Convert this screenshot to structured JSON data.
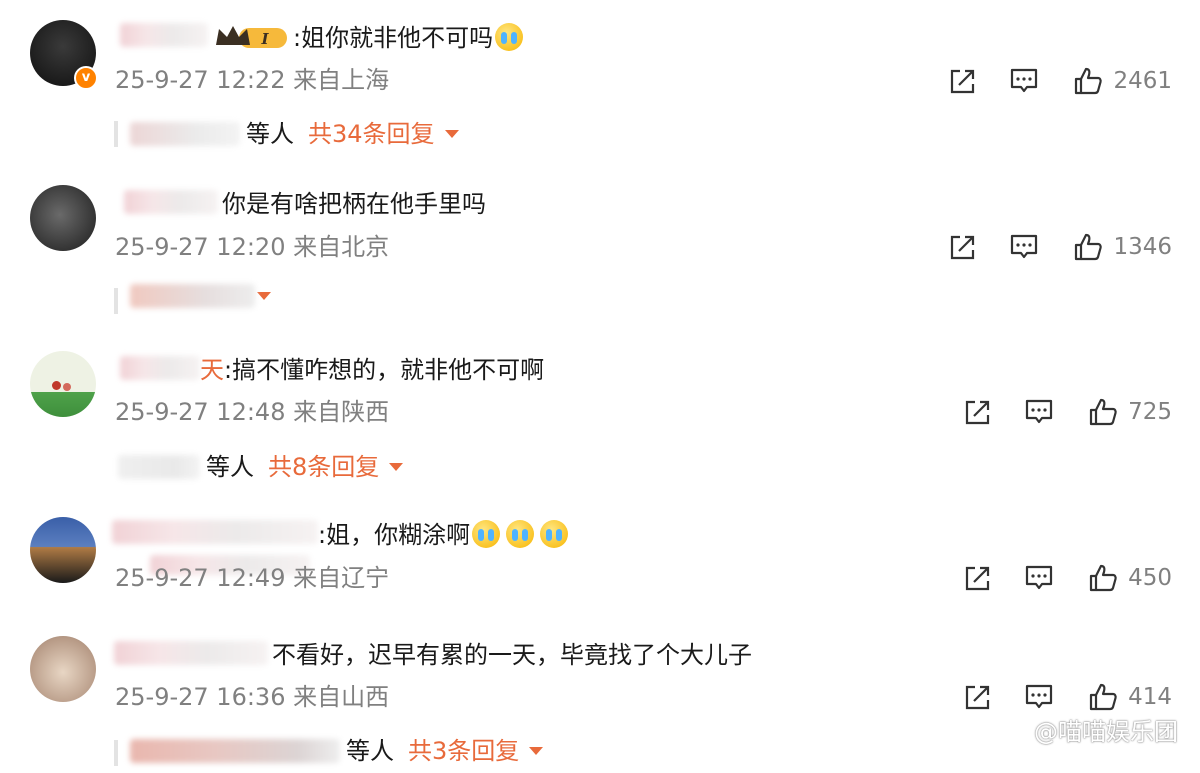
{
  "comments": [
    {
      "text": ":姐你就非他不可吗",
      "emoji_name": "pray-face-emoji",
      "time": "25-9-27 12:22",
      "location": "来自上海",
      "likes": "2461",
      "reply_suffix": "等人",
      "reply_count": "共34条回复"
    },
    {
      "text": "你是有啥把柄在他手里吗",
      "time": "25-9-27 12:20",
      "location": "来自北京",
      "likes": "1346"
    },
    {
      "name_visible": "天",
      "text": ":搞不懂咋想的，就非他不可啊",
      "time": "25-9-27 12:48",
      "location": "来自陕西",
      "likes": "725",
      "reply_suffix": "等人",
      "reply_count": "共8条回复"
    },
    {
      "text": ":姐，你糊涂啊",
      "emoji_name": "crying-face-emoji",
      "time": "25-9-27 12:49",
      "location": "来自辽宁",
      "likes": "450"
    },
    {
      "text": "不看好，迟早有累的一天，毕竟找了个大儿子",
      "time": "25-9-27 16:36",
      "location": "来自山西",
      "likes": "414",
      "reply_suffix": "等人",
      "reply_count": "共3条回复"
    }
  ],
  "badge": {
    "crown_label": "I"
  },
  "watermark": "@喵喵娱乐团",
  "colors": {
    "accent": "#e86a3b",
    "meta": "#808080",
    "vip": "#ff8200"
  },
  "icons": [
    "share-icon",
    "comment-icon",
    "like-icon",
    "chevron-down-icon"
  ]
}
